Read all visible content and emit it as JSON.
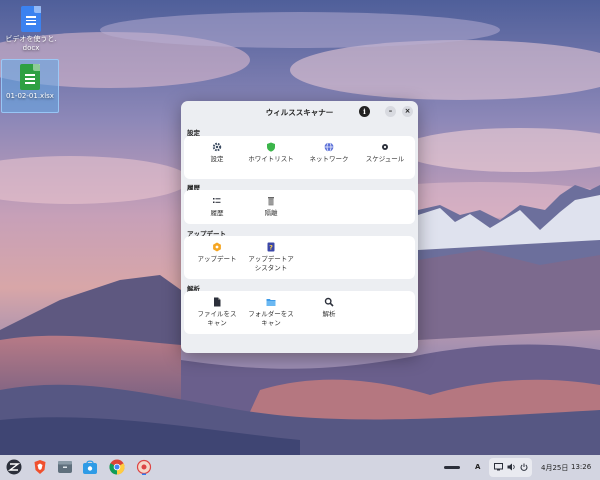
{
  "desktop": {
    "icons": [
      {
        "label": "ビデオを使うと\ndocx",
        "label_line1": "ビデオを使うと.",
        "label_line2": "docx",
        "icon": "docx-file-icon"
      },
      {
        "label": "01-02-01.xlsx",
        "icon": "xlsx-file-icon"
      }
    ]
  },
  "window": {
    "title": "ウィルススキャナー",
    "buttons": {
      "info": "i",
      "minimize": "–",
      "close": "×"
    },
    "sections": [
      {
        "label": "設定",
        "items": [
          "設定",
          "ホワイトリスト",
          "ネットワーク",
          "スケジュール"
        ]
      },
      {
        "label": "履歴",
        "items": [
          "履歴",
          "隔離"
        ]
      },
      {
        "label": "アップデート",
        "items": [
          "アップデート",
          "アップデートア\nシスタント"
        ]
      },
      {
        "label": "解析",
        "items": [
          "ファイルをス\nキャン",
          "フォルダーをス\nキャン",
          "解析"
        ]
      }
    ],
    "labels": {
      "s0": "設定",
      "s1": "履歴",
      "s2": "アップデート",
      "s3": "解析",
      "i00": "設定",
      "i01": "ホワイトリスト",
      "i02": "ネットワーク",
      "i03": "スケジュール",
      "i10": "履歴",
      "i11": "隔離",
      "i20": "アップデート",
      "i21a": "アップデートア",
      "i21b": "シスタント",
      "i30a": "ファイルをス",
      "i30b": "キャン",
      "i31a": "フォルダーをス",
      "i31b": "キャン",
      "i32": "解析"
    }
  },
  "taskbar": {
    "apps": [
      "zorin-menu-icon",
      "brave-browser-icon",
      "files-icon",
      "software-store-icon",
      "chrome-icon",
      "virus-scanner-app-icon"
    ],
    "tray": {
      "keyboard": "A",
      "date": "4月25日",
      "time": "13:26"
    }
  },
  "colors": {
    "accent": "#2e7df6",
    "green": "#3bb54a",
    "orange": "#f5a623"
  }
}
